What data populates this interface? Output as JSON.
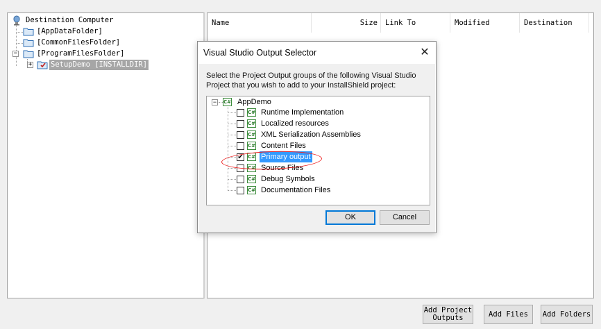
{
  "tree": {
    "root": "Destination Computer",
    "items": [
      {
        "label": "[AppDataFolder]"
      },
      {
        "label": "[CommonFilesFolder]"
      },
      {
        "label": "[ProgramFilesFolder]"
      },
      {
        "label": "SetupDemo [INSTALLDIR]"
      }
    ]
  },
  "list": {
    "columns": [
      "Name",
      "Size",
      "Link To",
      "Modified",
      "Destination"
    ]
  },
  "buttons": {
    "add_project_outputs": "Add Project Outputs",
    "add_files": "Add Files",
    "add_folders": "Add Folders"
  },
  "dialog": {
    "title": "Visual Studio Output Selector",
    "close": "✕",
    "description": "Select the Project Output groups of the following Visual Studio Project that you wish to add to your InstallShield project:",
    "project": "AppDemo",
    "project_icon": "C#",
    "outputs": [
      {
        "label": "Runtime Implementation",
        "checked": ""
      },
      {
        "label": "Localized resources",
        "checked": ""
      },
      {
        "label": "XML Serialization Assemblies",
        "checked": ""
      },
      {
        "label": "Content Files",
        "checked": ""
      },
      {
        "label": "Primary output",
        "checked": "✔"
      },
      {
        "label": "Source Files",
        "checked": ""
      },
      {
        "label": "Debug Symbols",
        "checked": ""
      },
      {
        "label": "Documentation Files",
        "checked": ""
      }
    ],
    "ok": "OK",
    "cancel": "Cancel"
  },
  "colors": {
    "selection": "#3399ff",
    "annotation": "#ee2222"
  }
}
